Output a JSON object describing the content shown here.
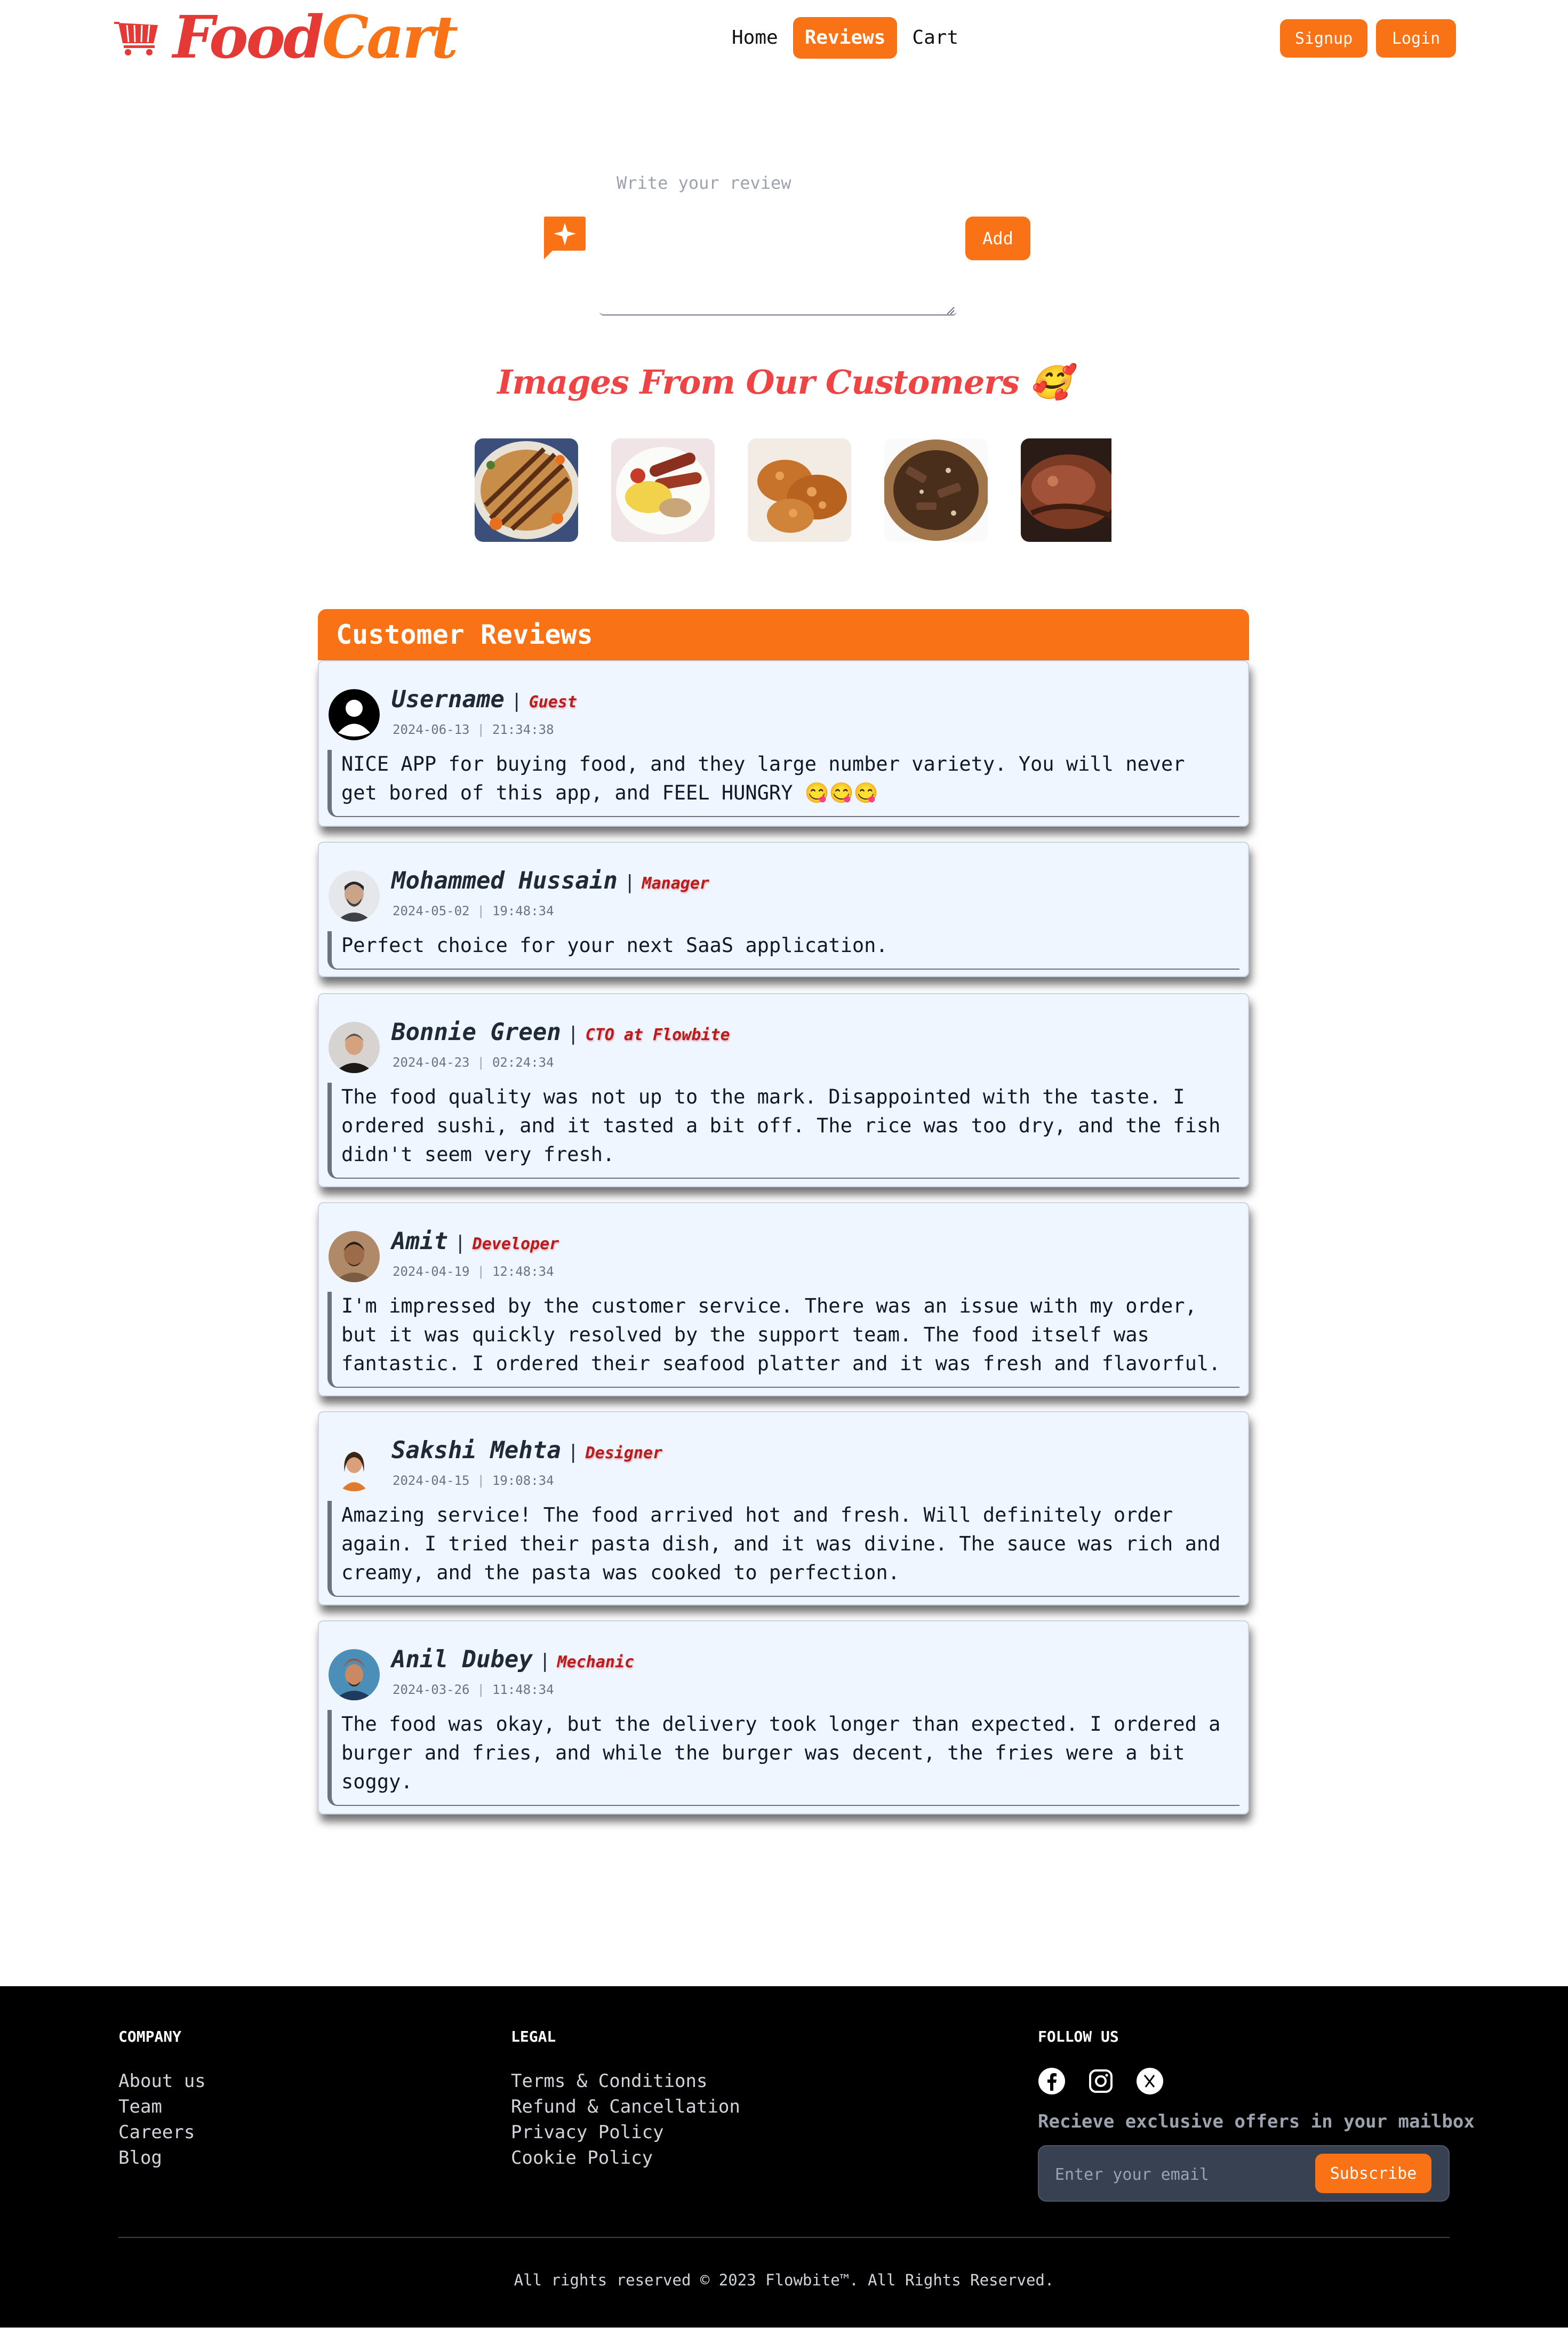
{
  "brand": {
    "name_part1": "Food",
    "name_part2": "Cart"
  },
  "nav": {
    "links": [
      {
        "label": "Home",
        "active": false
      },
      {
        "label": "Reviews",
        "active": true
      },
      {
        "label": "Cart",
        "active": false
      }
    ],
    "signup_label": "Signup",
    "login_label": "Login"
  },
  "review_form": {
    "placeholder": "Write your review",
    "add_label": "Add"
  },
  "gallery": {
    "title": "Images From Our Customers 🥰",
    "images": [
      "brisket-platter",
      "sausage-plate",
      "fried-chicken",
      "chocolate-platter",
      "roast-meat"
    ]
  },
  "reviews": {
    "header": "Customer Reviews",
    "items": [
      {
        "name": "Username",
        "role": "Guest",
        "date": "2024-06-13",
        "time": "21:34:38",
        "text": "NICE APP for buying food, and they large number variety. You will never get bored of this app, and FEEL HUNGRY 😋😋😋",
        "avatar": "default-user"
      },
      {
        "name": "Mohammed Hussain",
        "role": "Manager",
        "date": "2024-05-02",
        "time": "19:48:34",
        "text": "Perfect choice for your next SaaS application.",
        "avatar": "photo"
      },
      {
        "name": "Bonnie Green",
        "role": "CTO at Flowbite",
        "date": "2024-04-23",
        "time": "02:24:34",
        "text": "The food quality was not up to the mark. Disappointed with the taste. I ordered sushi, and it tasted a bit off. The rice was too dry, and the fish didn't seem very fresh.",
        "avatar": "photo"
      },
      {
        "name": "Amit",
        "role": "Developer",
        "date": "2024-04-19",
        "time": "12:48:34",
        "text": "I'm impressed by the customer service. There was an issue with my order, but it was quickly resolved by the support team. The food itself was fantastic. I ordered their seafood platter and it was fresh and flavorful.",
        "avatar": "photo"
      },
      {
        "name": "Sakshi Mehta",
        "role": "Designer",
        "date": "2024-04-15",
        "time": "19:08:34",
        "text": "Amazing service! The food arrived hot and fresh. Will definitely order again. I tried their pasta dish, and it was divine. The sauce was rich and creamy, and the pasta was cooked to perfection.",
        "avatar": "photo"
      },
      {
        "name": "Anil Dubey",
        "role": "Mechanic",
        "date": "2024-03-26",
        "time": "11:48:34",
        "text": "The food was okay, but the delivery took longer than expected. I ordered a burger and fries, and while the burger was decent, the fries were a bit soggy.",
        "avatar": "photo"
      }
    ]
  },
  "footer": {
    "company": {
      "heading": "COMPANY",
      "links": [
        "About us",
        "Team",
        "Careers",
        "Blog"
      ]
    },
    "legal": {
      "heading": "LEGAL",
      "links": [
        "Terms & Conditions",
        "Refund & Cancellation",
        "Privacy Policy",
        "Cookie Policy"
      ]
    },
    "follow": {
      "heading": "FOLLOW US",
      "icons": [
        "facebook-icon",
        "instagram-icon",
        "x-twitter-icon"
      ]
    },
    "mailbox_text": "Recieve exclusive offers in your mailbox",
    "email_placeholder": "Enter your email",
    "subscribe_label": "Subscribe",
    "copyright": "All rights reserved © 2023 Flowbite™. All Rights Reserved."
  },
  "colors": {
    "accent": "#f97316",
    "brand_red": "#e53935",
    "role_red": "#b91c1c",
    "card_bg": "#eff6ff",
    "footer_bg": "#000000"
  }
}
